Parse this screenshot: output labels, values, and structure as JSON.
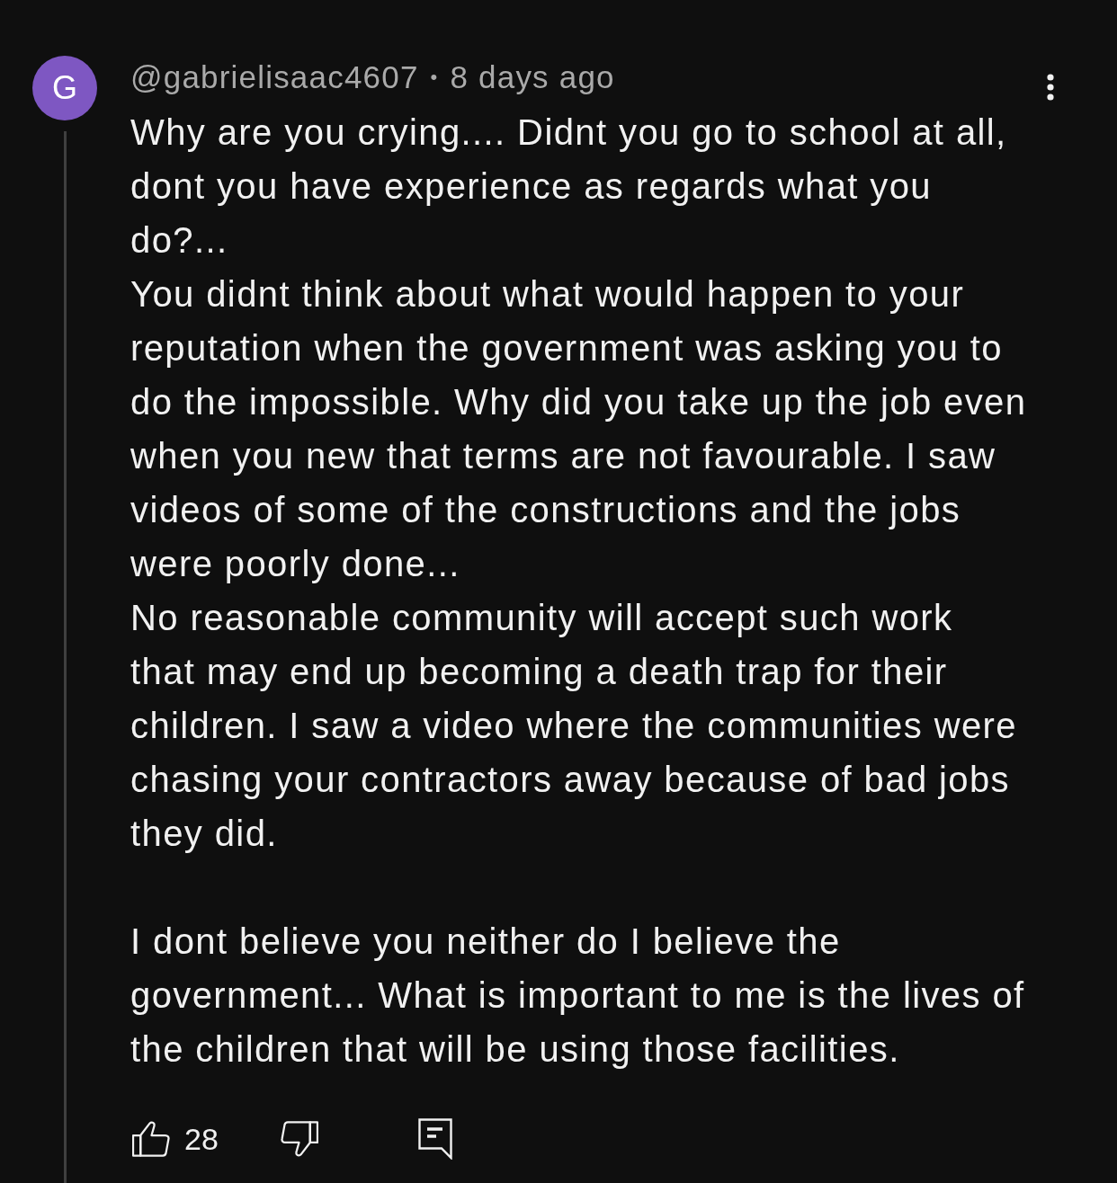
{
  "comment": {
    "avatar_letter": "G",
    "author": "@gabrielisaac4607",
    "separator": "•",
    "time": "8 days ago",
    "text": "Why are you crying.... Didnt you go to school at all, dont you have experience as regards what you do?...\nYou didnt think about what would happen to your reputation when the government was asking you to do the impossible. Why did you take up the job even when you new that terms are not favourable. I saw videos of some of the constructions and the jobs were poorly done...\nNo reasonable community will accept such work that may end up becoming a death trap for their children. I saw a video where the communities were chasing your contractors away because of bad jobs they did.\n\nI dont believe you neither do I believe the government... What is important to me is the lives of the children that will be using those facilities.",
    "likes": "28"
  }
}
